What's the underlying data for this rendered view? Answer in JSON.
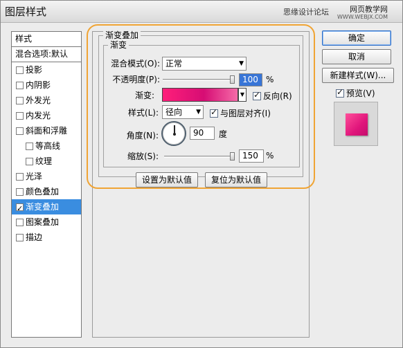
{
  "window": {
    "title": "图层样式",
    "watermark_left": "思缘设计论坛",
    "watermark_right": "网页教学网",
    "watermark_url": "WWW.WEBJX.COM"
  },
  "sidebar": {
    "header": "样式",
    "blend_options": "混合选项:默认",
    "items": [
      {
        "label": "投影",
        "checked": false
      },
      {
        "label": "内阴影",
        "checked": false
      },
      {
        "label": "外发光",
        "checked": false
      },
      {
        "label": "内发光",
        "checked": false
      },
      {
        "label": "斜面和浮雕",
        "checked": false
      },
      {
        "label": "等高线",
        "checked": false,
        "indent": true
      },
      {
        "label": "纹理",
        "checked": false,
        "indent": true
      },
      {
        "label": "光泽",
        "checked": false
      },
      {
        "label": "颜色叠加",
        "checked": false
      },
      {
        "label": "渐变叠加",
        "checked": true,
        "selected": true
      },
      {
        "label": "图案叠加",
        "checked": false
      },
      {
        "label": "描边",
        "checked": false
      }
    ]
  },
  "panel": {
    "group_title": "渐变叠加",
    "subgroup_title": "渐变",
    "blend_mode_label": "混合模式(O):",
    "blend_mode_value": "正常",
    "opacity_label": "不透明度(P):",
    "opacity_value": "100",
    "opacity_unit": "%",
    "opacity_level": 1.0,
    "gradient_label": "渐变:",
    "reverse_label": "反向(R)",
    "reverse_checked": true,
    "style_label": "样式(L):",
    "style_value": "径向",
    "align_label": "与图层对齐(I)",
    "align_checked": true,
    "angle_label": "角度(N):",
    "angle_value": "90",
    "angle_unit": "度",
    "scale_label": "缩放(S):",
    "scale_value": "150",
    "scale_unit": "%",
    "scale_level": 1.0,
    "make_default": "设置为默认值",
    "reset_default": "复位为默认值",
    "gradient_colors": [
      "#ff1f7a",
      "#d60d74",
      "#f56ba8"
    ]
  },
  "actions": {
    "ok": "确定",
    "cancel": "取消",
    "new_style": "新建样式(W)...",
    "preview_label": "预览(V)",
    "preview_checked": true
  },
  "colors": {
    "highlight": "#f0a434",
    "selection": "#3a8de0"
  }
}
